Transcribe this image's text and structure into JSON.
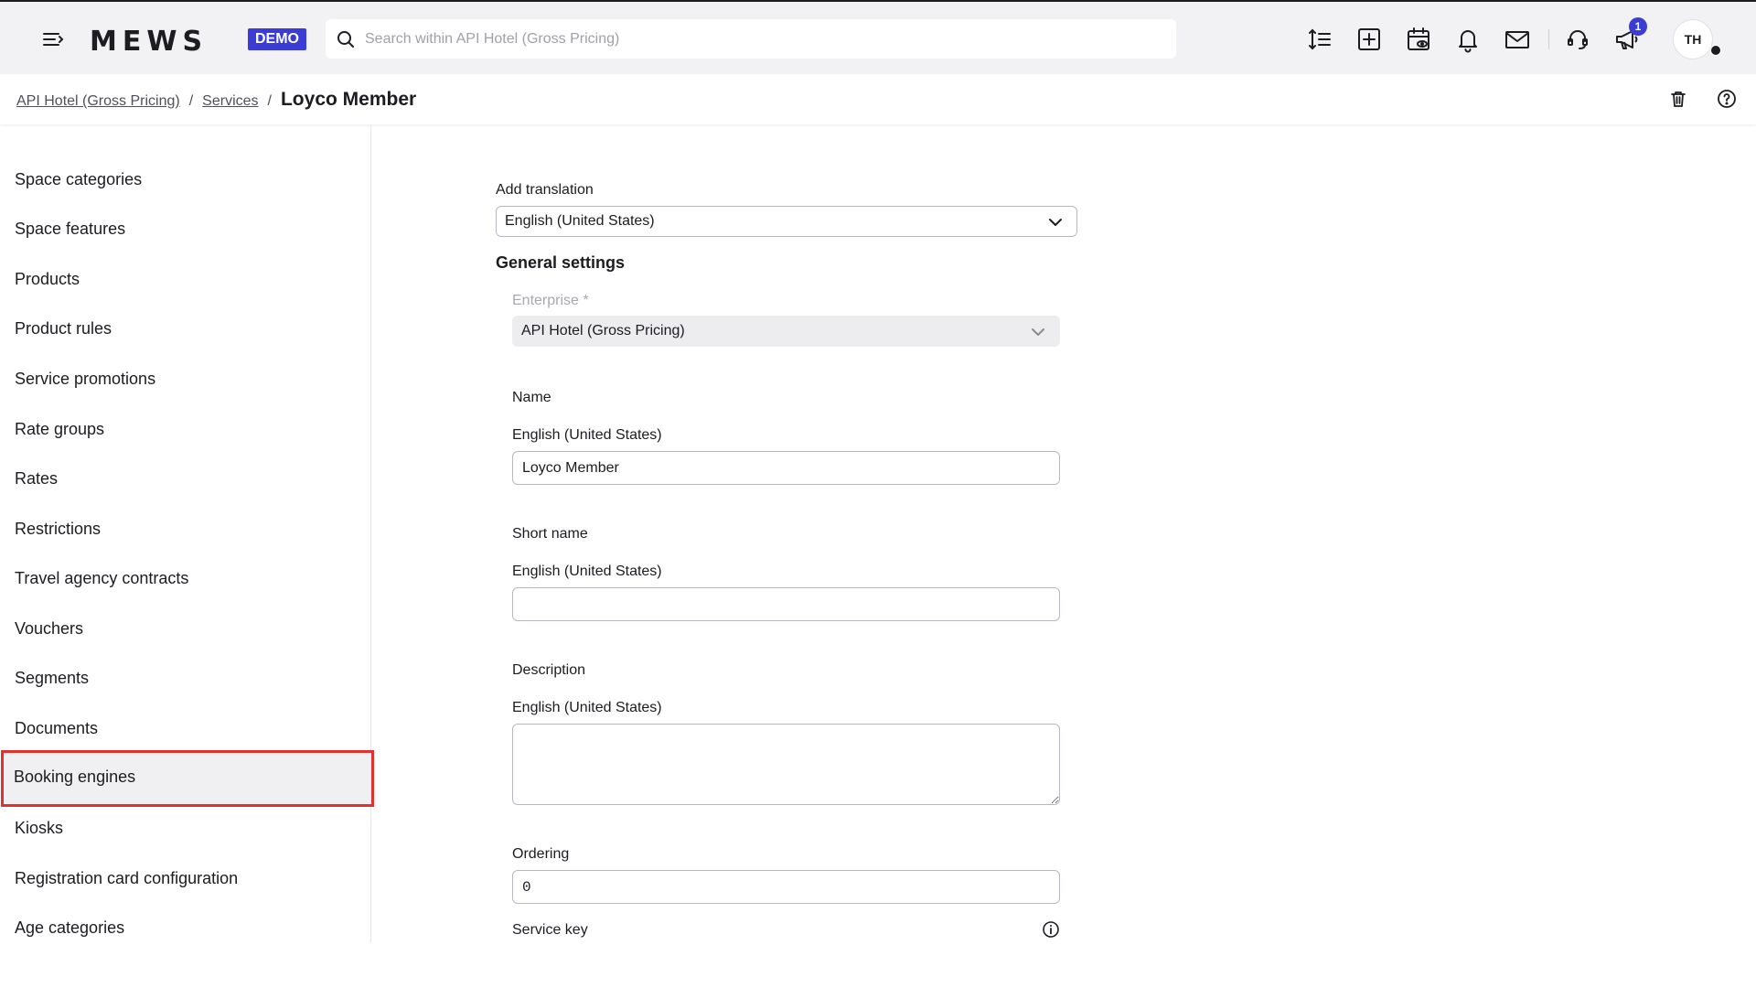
{
  "topbar": {
    "logo": "MEWS",
    "demo_badge": "DEMO",
    "search_placeholder": "Search within API Hotel (Gross Pricing)",
    "notification_count": "1",
    "avatar_initials": "TH"
  },
  "breadcrumb": {
    "items": [
      "API Hotel (Gross Pricing)",
      "Services"
    ],
    "separator": "/",
    "current": "Loyco Member"
  },
  "sidebar": {
    "items": [
      {
        "label": "Space categories"
      },
      {
        "label": "Space features"
      },
      {
        "label": "Products"
      },
      {
        "label": "Product rules"
      },
      {
        "label": "Service promotions"
      },
      {
        "label": "Rate groups"
      },
      {
        "label": "Rates"
      },
      {
        "label": "Restrictions"
      },
      {
        "label": "Travel agency contracts"
      },
      {
        "label": "Vouchers"
      },
      {
        "label": "Segments"
      },
      {
        "label": "Documents"
      },
      {
        "label": "Booking engines"
      },
      {
        "label": "Kiosks"
      },
      {
        "label": "Registration card configuration"
      },
      {
        "label": "Age categories"
      }
    ],
    "active_item": "Booking engines"
  },
  "form": {
    "add_translation_label": "Add translation",
    "add_translation_value": "English (United States)",
    "general_settings_title": "General settings",
    "enterprise_label": "Enterprise *",
    "enterprise_value": "API Hotel (Gross Pricing)",
    "name_section": "Name",
    "name_lang": "English (United States)",
    "name_value": "Loyco Member",
    "short_name_section": "Short name",
    "short_name_lang": "English (United States)",
    "short_name_value": "",
    "description_section": "Description",
    "description_lang": "English (United States)",
    "description_value": "",
    "ordering_label": "Ordering",
    "ordering_value": "0",
    "service_key_label": "Service key"
  },
  "colors": {
    "accent": "#3b3bd6",
    "highlight_border": "#e03030"
  }
}
